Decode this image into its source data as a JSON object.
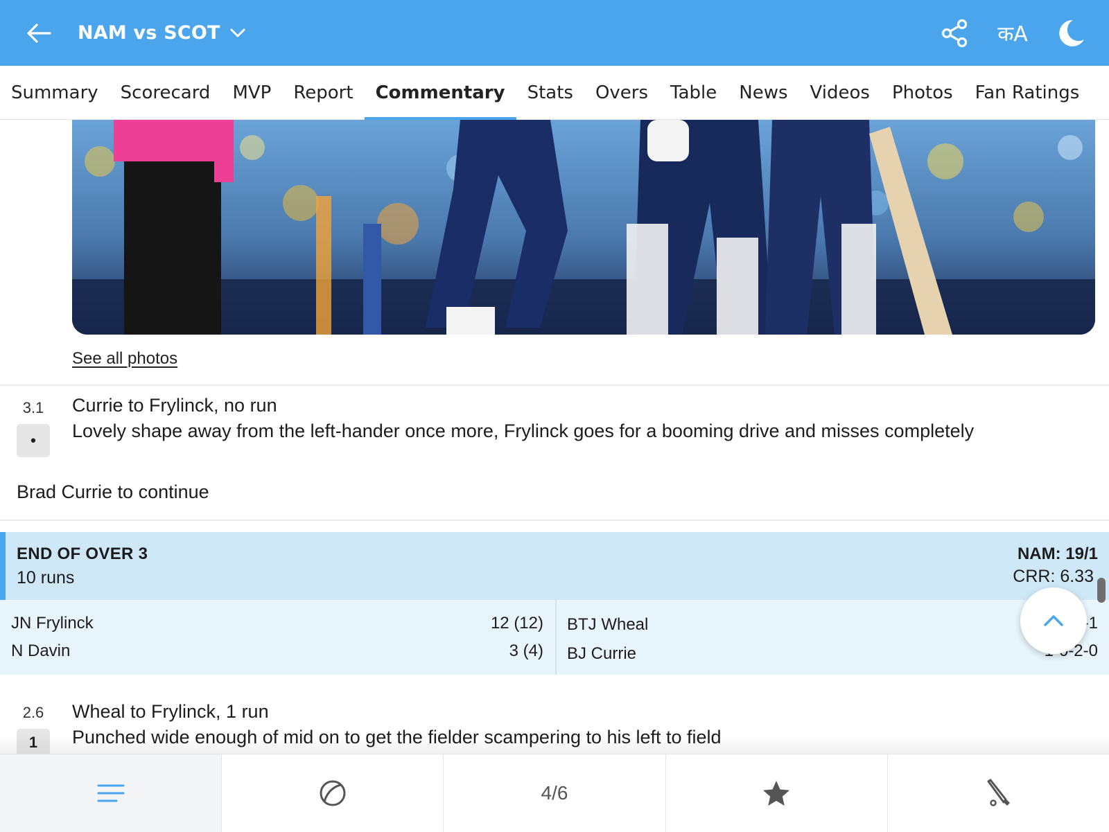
{
  "header": {
    "title": "NAM vs SCOT",
    "lang_icon": "कA"
  },
  "tabs": [
    {
      "label": "Summary"
    },
    {
      "label": "Scorecard"
    },
    {
      "label": "MVP"
    },
    {
      "label": "Report"
    },
    {
      "label": "Commentary",
      "active": true
    },
    {
      "label": "Stats"
    },
    {
      "label": "Overs"
    },
    {
      "label": "Table"
    },
    {
      "label": "News"
    },
    {
      "label": "Videos"
    },
    {
      "label": "Photos"
    },
    {
      "label": "Fan Ratings"
    }
  ],
  "photos_link": "See all photos",
  "commentary": [
    {
      "over": "3.1",
      "badge": "•",
      "headline": "Currie to Frylinck, no run",
      "text": "Lovely shape away from the left-hander once more, Frylinck goes for a booming drive and misses completely"
    },
    {
      "over": "2.6",
      "badge": "1",
      "headline": "Wheal to Frylinck, 1 run",
      "text": "Punched wide enough of mid on to get the fielder scampering to his left to field"
    }
  ],
  "note": "Brad Currie to continue",
  "over_summary": {
    "title": "END OF OVER 3",
    "runs": "10 runs",
    "score": "NAM: 19/1",
    "crr": "CRR: 6.33",
    "batters": [
      {
        "name": "JN Frylinck",
        "stat": "12 (12)"
      },
      {
        "name": "N Davin",
        "stat": "3 (4)"
      }
    ],
    "bowlers": [
      {
        "name": "BTJ Wheal",
        "stat": "-1"
      },
      {
        "name": "BJ Currie",
        "stat": "1-0-2-0"
      }
    ]
  },
  "bottom_nav": {
    "counter": "4/6"
  },
  "colors": {
    "header_bg": "#4ba5ec",
    "accent": "#4ba5ec",
    "over_bg": "#cfe8f8",
    "players_bg": "#e8f5fd"
  }
}
